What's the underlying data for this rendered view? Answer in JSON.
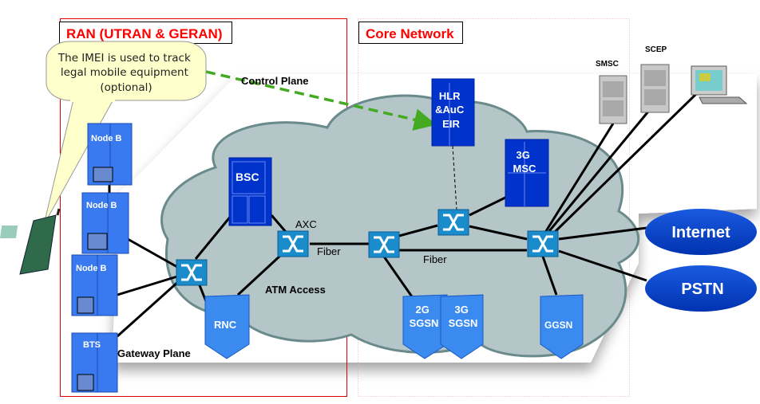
{
  "regions": {
    "ran": "RAN (UTRAN & GERAN)",
    "core": "Core Network"
  },
  "callout": {
    "lines": [
      "The IMEI is used to track",
      "legal mobile equipment",
      "(optional)"
    ]
  },
  "planes": {
    "control": "Control Plane",
    "gateway": "Gateway Plane"
  },
  "cloud_labels": {
    "atm": "ATM  Access",
    "axc": "AXC",
    "fiber1": "Fiber",
    "fiber2": "Fiber"
  },
  "nodes": {
    "nodeb1": "Node B",
    "nodeb2": "Node B",
    "nodeb3": "Node B",
    "bts": "BTS",
    "bsc": "BSC",
    "rnc": "RNC",
    "hlr": [
      "HLR",
      "&AuC",
      "EIR"
    ],
    "msc": [
      "3G",
      "MSC"
    ],
    "sgsn2g": [
      "2G",
      "SGSN"
    ],
    "sgsn3g": [
      "3G",
      "SGSN"
    ],
    "ggsn": "GGSN",
    "smsc": "SMSC",
    "scep": "SCEP",
    "internet": "Internet",
    "pstn": "PSTN"
  },
  "colors": {
    "region_border": "#e00000",
    "region_label": "#ff0000",
    "cloud_fill": "#b4c6c8",
    "cloud_stroke": "#6a8a8c",
    "equipment_blue": "#0033cc",
    "node_blue": "#3a7af0",
    "switch_blue": "#1a8ccc",
    "callout_fill": "#ffffcc",
    "control_link": "#44aa22",
    "ellipse_blue": "#0044cc"
  }
}
